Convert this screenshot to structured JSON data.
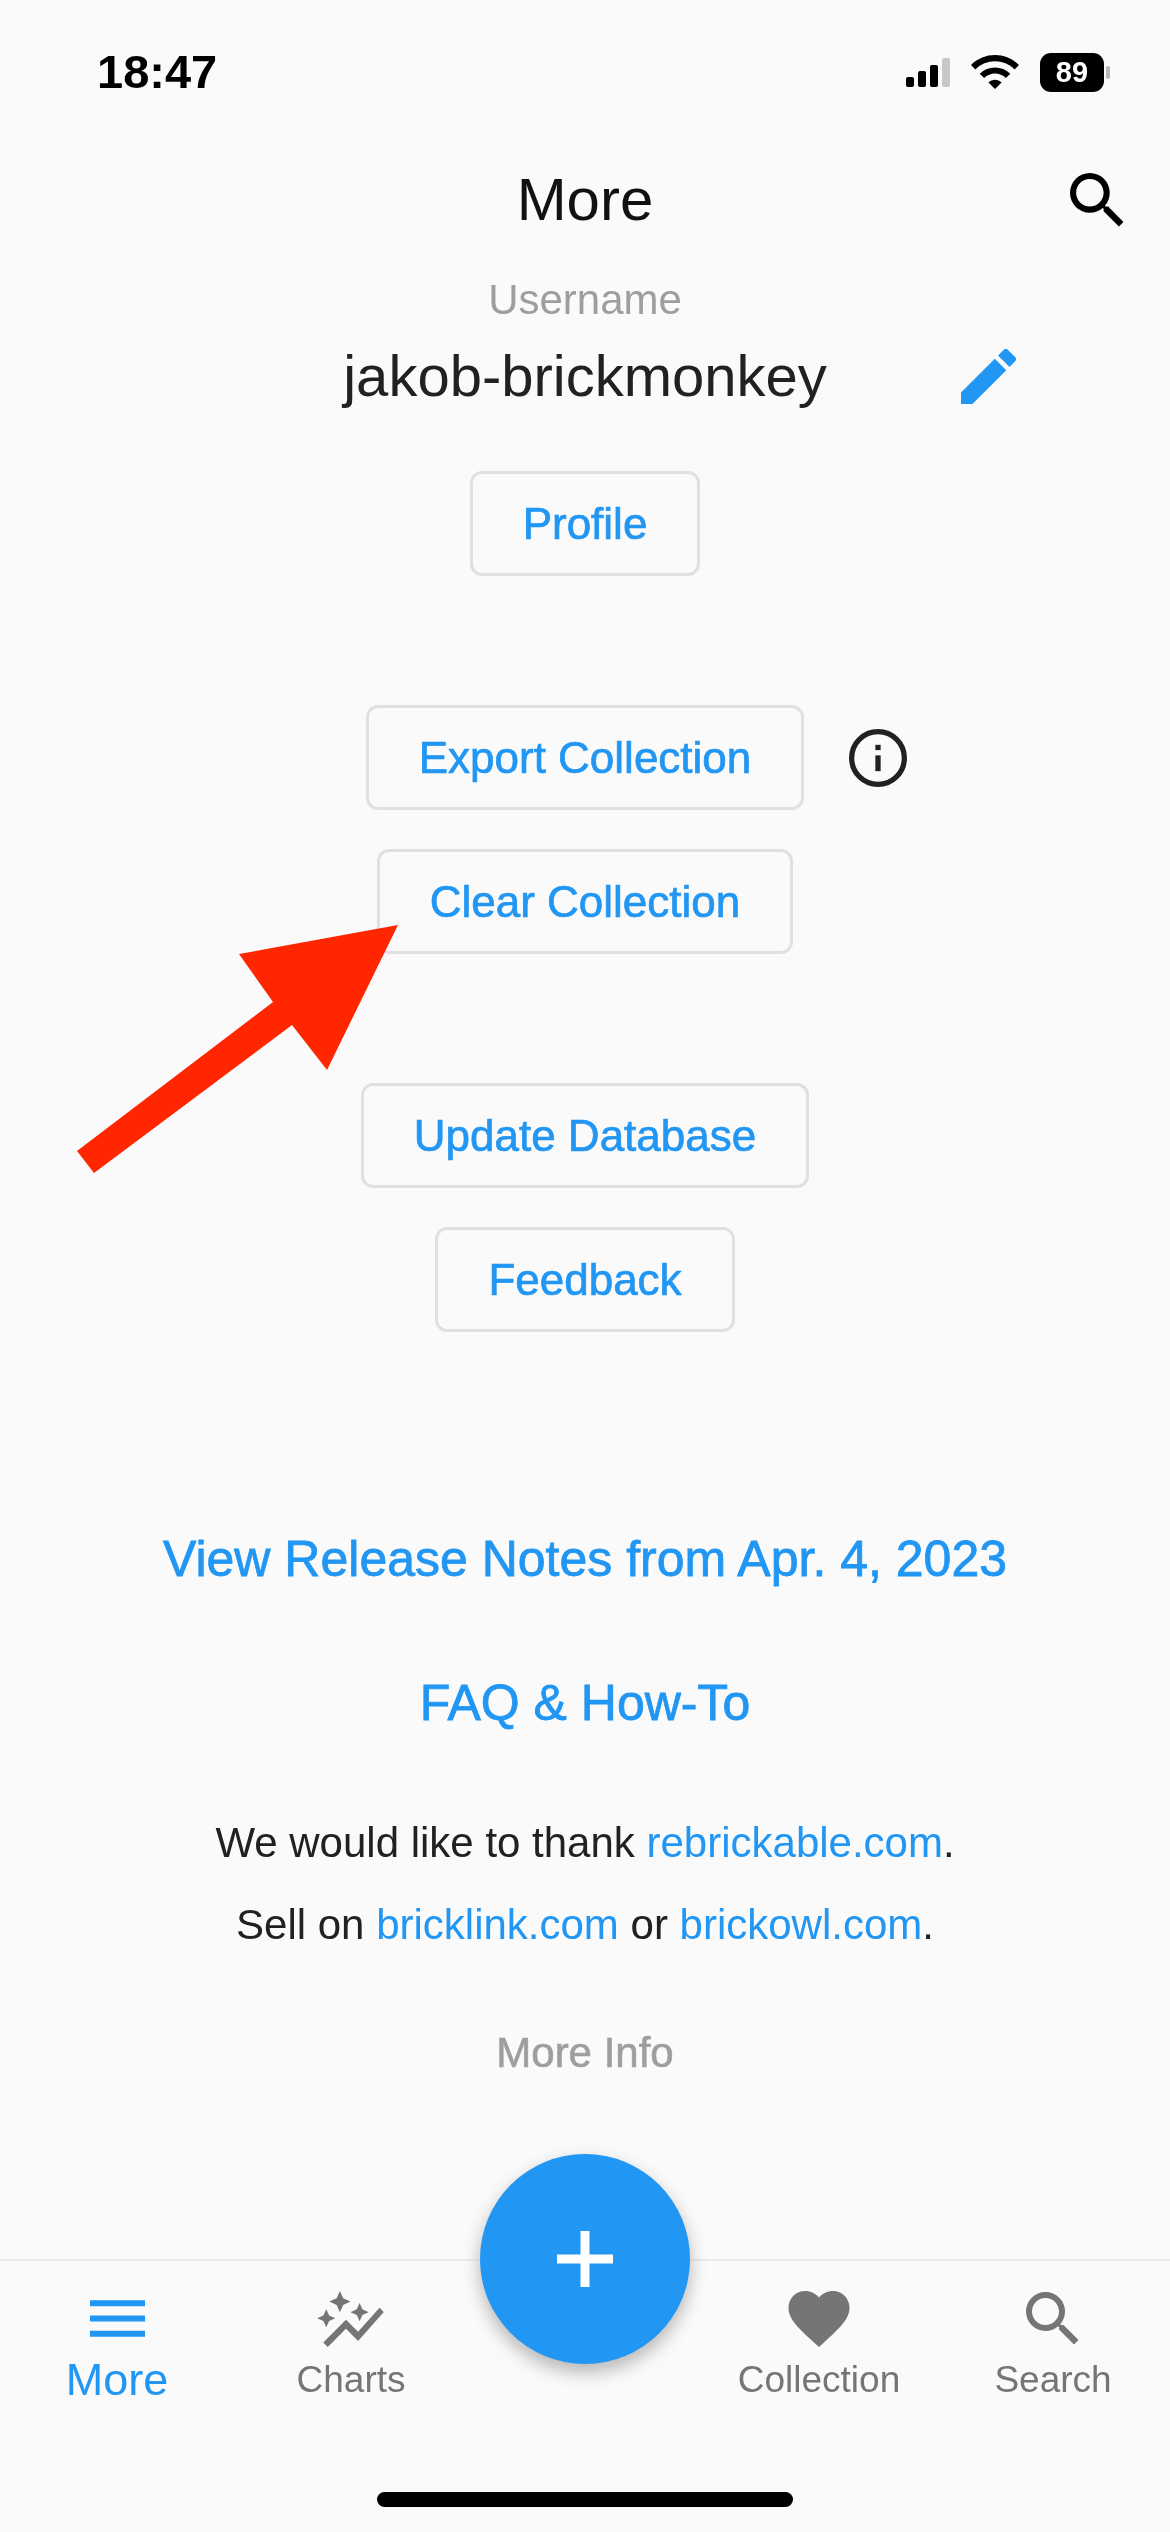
{
  "status_bar": {
    "time": "18:47",
    "battery": "89"
  },
  "app_bar": {
    "title": "More"
  },
  "profile": {
    "label": "Username",
    "username": "jakob-brickmonkey",
    "button": "Profile"
  },
  "action_groups": [
    {
      "buttons": [
        {
          "label": "Export Collection",
          "info": true
        },
        {
          "label": "Clear Collection",
          "info": false
        }
      ]
    },
    {
      "buttons": [
        {
          "label": "Update Database",
          "info": false
        },
        {
          "label": "Feedback",
          "info": false
        }
      ]
    }
  ],
  "annotations": [
    {
      "kind": "arrow"
    }
  ],
  "links": [
    "View Release Notes from Apr. 4, 2023",
    "FAQ & How-To"
  ],
  "credits": [
    [
      {
        "kind": "plain",
        "text": "We would like to thank "
      },
      {
        "kind": "link",
        "text": "rebrickable.com"
      },
      {
        "kind": "plain",
        "text": "."
      }
    ],
    [
      {
        "kind": "plain",
        "text": "Sell on "
      },
      {
        "kind": "link",
        "text": "bricklink.com"
      },
      {
        "kind": "plain",
        "text": " or "
      },
      {
        "kind": "link",
        "text": "brickowl.com"
      },
      {
        "kind": "plain",
        "text": "."
      }
    ]
  ],
  "more_info": "More Info",
  "bottom_nav": [
    {
      "label": "More",
      "selected": true
    },
    {
      "label": "Charts",
      "selected": false
    },
    {
      "label": "Collection",
      "selected": false
    },
    {
      "label": "Search",
      "selected": false
    }
  ]
}
